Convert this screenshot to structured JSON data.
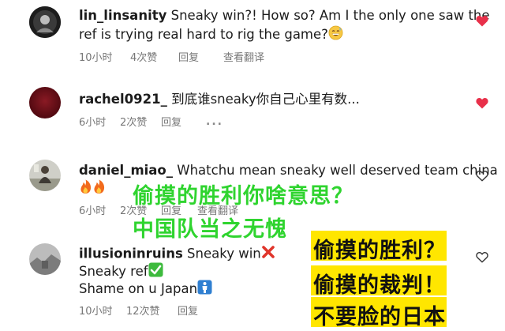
{
  "colors": {
    "heart": "#e8304a",
    "meta_text": "#777777",
    "overlay_green": "#2fd42f",
    "overlay_yellow": "#ffe600"
  },
  "comments": [
    {
      "username": "lin_linsanity",
      "line1": "Sneaky win?! How so? Am I the only one saw the",
      "line2": "ref is trying real hard to rig the game?",
      "emoji": "grinning-sweat-emoji",
      "time": "10小时",
      "likes": "4次赞",
      "reply": "回复",
      "translate": "查看翻译",
      "liked": true
    },
    {
      "username": "rachel0921_",
      "line1": "到底谁sneaky你自己心里有数...",
      "time": "6小时",
      "likes": "2次赞",
      "reply": "回复",
      "more": "...",
      "liked": true
    },
    {
      "username": "daniel_miao_",
      "line1": "Whatchu mean sneaky well deserved team china",
      "emoji": "fire-emoji",
      "time": "6小时",
      "likes": "2次赞",
      "reply": "回复",
      "translate": "查看翻译",
      "liked": false
    },
    {
      "username": "illusioninruins",
      "line1": "Sneaky win",
      "line2": "Sneaky ref",
      "line3": "Shame on u Japan",
      "time": "10小时",
      "likes": "12次赞",
      "reply": "回复",
      "liked": false
    }
  ],
  "overlays": {
    "green_line1": "偷摸的胜利你啥意思？",
    "green_line2": "中国队当之无愧",
    "yellow_line1": "偷摸的胜利？",
    "yellow_line2": "偷摸的裁判！",
    "yellow_line3": "不要脸的日本"
  }
}
